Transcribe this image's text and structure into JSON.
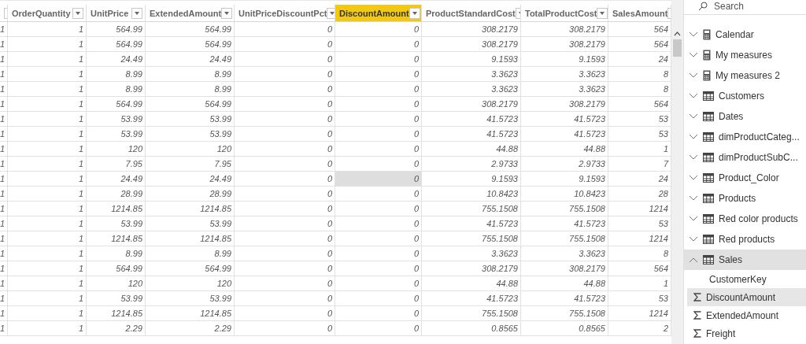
{
  "table": {
    "columns": [
      {
        "selected": false
      },
      {
        "label": "OrderQuantity",
        "selected": false
      },
      {
        "label": "UnitPrice",
        "selected": false
      },
      {
        "label": "ExtendedAmount",
        "selected": false
      },
      {
        "label": "UnitPriceDiscountPct",
        "selected": false
      },
      {
        "label": "DiscountAmount",
        "selected": true
      },
      {
        "label": "ProductStandardCost",
        "selected": false
      },
      {
        "label": "TotalProductCost",
        "selected": false
      },
      {
        "label": "SalesAmount",
        "selected": false
      }
    ],
    "rows": [
      {
        "cells": [
          "1",
          "1",
          "564.99",
          "564.99",
          "0",
          "0",
          "308.2179",
          "308.2179",
          "564"
        ],
        "focused_cell": false
      },
      {
        "cells": [
          "1",
          "1",
          "564.99",
          "564.99",
          "0",
          "0",
          "308.2179",
          "308.2179",
          "564"
        ],
        "focused_cell": false
      },
      {
        "cells": [
          "1",
          "1",
          "24.49",
          "24.49",
          "0",
          "0",
          "9.1593",
          "9.1593",
          "24"
        ],
        "focused_cell": false
      },
      {
        "cells": [
          "1",
          "1",
          "8.99",
          "8.99",
          "0",
          "0",
          "3.3623",
          "3.3623",
          "8"
        ],
        "focused_cell": false
      },
      {
        "cells": [
          "1",
          "1",
          "8.99",
          "8.99",
          "0",
          "0",
          "3.3623",
          "3.3623",
          "8"
        ],
        "focused_cell": false
      },
      {
        "cells": [
          "1",
          "1",
          "564.99",
          "564.99",
          "0",
          "0",
          "308.2179",
          "308.2179",
          "564"
        ],
        "focused_cell": false
      },
      {
        "cells": [
          "1",
          "1",
          "53.99",
          "53.99",
          "0",
          "0",
          "41.5723",
          "41.5723",
          "53"
        ],
        "focused_cell": false
      },
      {
        "cells": [
          "1",
          "1",
          "53.99",
          "53.99",
          "0",
          "0",
          "41.5723",
          "41.5723",
          "53"
        ],
        "focused_cell": false
      },
      {
        "cells": [
          "1",
          "1",
          "120",
          "120",
          "0",
          "0",
          "44.88",
          "44.88",
          "1"
        ],
        "focused_cell": false
      },
      {
        "cells": [
          "1",
          "1",
          "7.95",
          "7.95",
          "0",
          "0",
          "2.9733",
          "2.9733",
          "7"
        ],
        "focused_cell": false
      },
      {
        "cells": [
          "1",
          "1",
          "24.49",
          "24.49",
          "0",
          "0",
          "9.1593",
          "9.1593",
          "24"
        ],
        "focused_cell": true
      },
      {
        "cells": [
          "1",
          "1",
          "28.99",
          "28.99",
          "0",
          "0",
          "10.8423",
          "10.8423",
          "28"
        ],
        "focused_cell": false
      },
      {
        "cells": [
          "1",
          "1",
          "1214.85",
          "1214.85",
          "0",
          "0",
          "755.1508",
          "755.1508",
          "1214"
        ],
        "focused_cell": false
      },
      {
        "cells": [
          "1",
          "1",
          "53.99",
          "53.99",
          "0",
          "0",
          "41.5723",
          "41.5723",
          "53"
        ],
        "focused_cell": false
      },
      {
        "cells": [
          "1",
          "1",
          "1214.85",
          "1214.85",
          "0",
          "0",
          "755.1508",
          "755.1508",
          "1214"
        ],
        "focused_cell": false
      },
      {
        "cells": [
          "1",
          "1",
          "8.99",
          "8.99",
          "0",
          "0",
          "3.3623",
          "3.3623",
          "8"
        ],
        "focused_cell": false
      },
      {
        "cells": [
          "1",
          "1",
          "564.99",
          "564.99",
          "0",
          "0",
          "308.2179",
          "308.2179",
          "564"
        ],
        "focused_cell": false
      },
      {
        "cells": [
          "1",
          "1",
          "120",
          "120",
          "0",
          "0",
          "44.88",
          "44.88",
          "1"
        ],
        "focused_cell": false
      },
      {
        "cells": [
          "1",
          "1",
          "53.99",
          "53.99",
          "0",
          "0",
          "41.5723",
          "41.5723",
          "53"
        ],
        "focused_cell": false
      },
      {
        "cells": [
          "1",
          "1",
          "1214.85",
          "1214.85",
          "0",
          "0",
          "755.1508",
          "755.1508",
          "1214"
        ],
        "focused_cell": false
      },
      {
        "cells": [
          "1",
          "1",
          "2.29",
          "2.29",
          "0",
          "0",
          "0.8565",
          "0.8565",
          "2"
        ],
        "focused_cell": false
      }
    ]
  },
  "fields": {
    "search": {
      "placeholder": "Search"
    },
    "items": [
      {
        "label": "Calendar",
        "kind": "measure",
        "expanded": false,
        "selected": false
      },
      {
        "label": "My measures",
        "kind": "measure",
        "expanded": false,
        "selected": false
      },
      {
        "label": "My measures 2",
        "kind": "measure",
        "expanded": false,
        "selected": false
      },
      {
        "label": "Customers",
        "kind": "table",
        "expanded": false,
        "selected": false
      },
      {
        "label": "Dates",
        "kind": "table",
        "expanded": false,
        "selected": false
      },
      {
        "label": "dimProductCateg...",
        "kind": "table",
        "expanded": false,
        "selected": false
      },
      {
        "label": "dimProductSubC...",
        "kind": "table",
        "expanded": false,
        "selected": false
      },
      {
        "label": "Product_Color",
        "kind": "table",
        "expanded": false,
        "selected": false
      },
      {
        "label": "Products",
        "kind": "table",
        "expanded": false,
        "selected": false
      },
      {
        "label": "Red color products",
        "kind": "table",
        "expanded": false,
        "selected": false
      },
      {
        "label": "Red products",
        "kind": "table",
        "expanded": false,
        "selected": false
      },
      {
        "label": "Sales",
        "kind": "table",
        "expanded": true,
        "selected": true,
        "children": [
          {
            "label": "CustomerKey",
            "kind": "field",
            "selected": false
          },
          {
            "label": "DiscountAmount",
            "kind": "sum",
            "selected": true
          },
          {
            "label": "ExtendedAmount",
            "kind": "sum",
            "selected": false
          },
          {
            "label": "Freight",
            "kind": "sum",
            "selected": false
          }
        ]
      }
    ]
  }
}
